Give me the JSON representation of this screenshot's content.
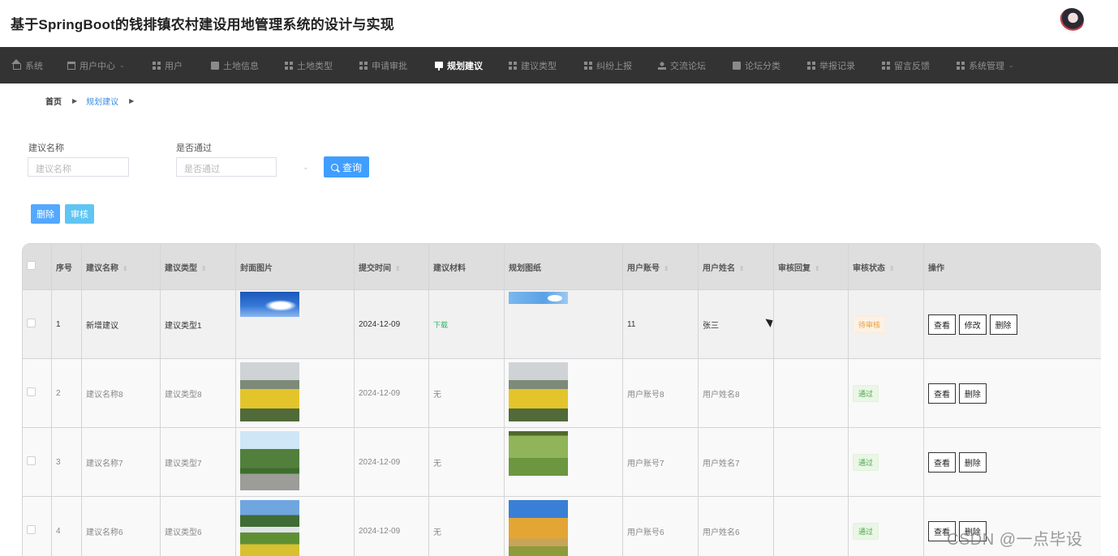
{
  "header": {
    "title": "基于SpringBoot的钱排镇农村建设用地管理系统的设计与实现"
  },
  "nav": {
    "items": [
      {
        "label": "系统",
        "icon": "home-icon"
      },
      {
        "label": "用户中心",
        "icon": "window-icon",
        "dropdown": true
      },
      {
        "label": "用户",
        "icon": "grid-icon"
      },
      {
        "label": "土地信息",
        "icon": "clipboard-icon"
      },
      {
        "label": "土地类型",
        "icon": "grid-icon"
      },
      {
        "label": "申请审批",
        "icon": "grid-icon"
      },
      {
        "label": "规划建议",
        "icon": "board-icon",
        "active": true
      },
      {
        "label": "建议类型",
        "icon": "grid-icon"
      },
      {
        "label": "纠纷上报",
        "icon": "grid-icon"
      },
      {
        "label": "交流论坛",
        "icon": "user-icon"
      },
      {
        "label": "论坛分类",
        "icon": "clipboard-icon"
      },
      {
        "label": "举报记录",
        "icon": "grid-icon"
      },
      {
        "label": "留言反馈",
        "icon": "grid-icon"
      },
      {
        "label": "系统管理",
        "icon": "grid-icon",
        "dropdown": true
      }
    ]
  },
  "breadcrumb": {
    "home": "首页",
    "current": "规划建议"
  },
  "search": {
    "name_label": "建议名称",
    "name_placeholder": "建议名称",
    "pass_label": "是否通过",
    "pass_placeholder": "是否通过",
    "query_label": "查询"
  },
  "actions": {
    "delete_label": "删除",
    "audit_label": "审核"
  },
  "table": {
    "headers": [
      "序号",
      "建议名称",
      "建议类型",
      "封面图片",
      "提交时间",
      "建议材料",
      "规划图纸",
      "用户账号",
      "用户姓名",
      "审核回复",
      "审核状态",
      "操作"
    ],
    "rows": [
      {
        "index": "1",
        "name": "新增建议",
        "type": "建议类型1",
        "time": "2024-12-09",
        "material": "下载",
        "account": "11",
        "user": "张三",
        "reply": "",
        "status": "待审核",
        "ops": [
          "查看",
          "修改",
          "删除"
        ]
      },
      {
        "index": "2",
        "name": "建议名称8",
        "type": "建议类型8",
        "time": "2024-12-09",
        "material": "无",
        "account": "用户账号8",
        "user": "用户姓名8",
        "reply": "",
        "status": "通过",
        "ops": [
          "查看",
          "删除"
        ]
      },
      {
        "index": "3",
        "name": "建议名称7",
        "type": "建议类型7",
        "time": "2024-12-09",
        "material": "无",
        "account": "用户账号7",
        "user": "用户姓名7",
        "reply": "",
        "status": "通过",
        "ops": [
          "查看",
          "删除"
        ]
      },
      {
        "index": "4",
        "name": "建议名称6",
        "type": "建议类型6",
        "time": "2024-12-09",
        "material": "无",
        "account": "用户账号6",
        "user": "用户姓名6",
        "reply": "",
        "status": "通过",
        "ops": [
          "查看",
          "删除"
        ]
      }
    ]
  },
  "colors": {
    "nav_bg": "#333333",
    "primary": "#409eff",
    "pending": "#e6a23c",
    "pass": "#4aa84a"
  },
  "watermark": "CSDN @一点毕设"
}
